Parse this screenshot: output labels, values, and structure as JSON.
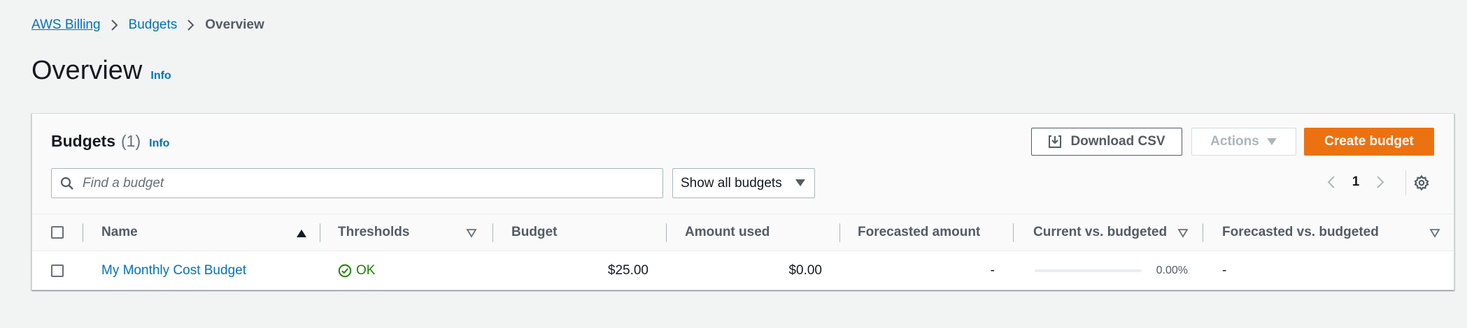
{
  "breadcrumb": {
    "items": [
      "AWS Billing",
      "Budgets"
    ],
    "current": "Overview"
  },
  "page": {
    "title": "Overview",
    "info": "Info"
  },
  "panel": {
    "title": "Budgets",
    "count": "(1)",
    "info": "Info",
    "download_label": "Download CSV",
    "actions_label": "Actions",
    "create_label": "Create budget",
    "search_placeholder": "Find a budget",
    "filter_value": "Show all budgets",
    "page_number": "1"
  },
  "table": {
    "columns": [
      "Name",
      "Thresholds",
      "Budget",
      "Amount used",
      "Forecasted amount",
      "Current vs. budgeted",
      "Forecasted vs. budgeted"
    ],
    "rows": [
      {
        "name": "My Monthly Cost Budget",
        "thresholds": "OK",
        "budget": "$25.00",
        "amount_used": "$0.00",
        "forecasted_amount": "-",
        "current_vs_budgeted": "0.00%",
        "current_vs_budgeted_fraction": 0,
        "forecasted_vs_budgeted": "-"
      }
    ]
  },
  "colors": {
    "link": "#0073bb",
    "primary_button": "#ec7211",
    "status_ok": "#1d8102"
  },
  "icons": [
    "chevron-right-icon",
    "download-icon",
    "caret-down-icon",
    "search-icon",
    "chevron-left-icon",
    "settings-icon",
    "sort-ascending-icon",
    "sort-icon",
    "status-ok-icon"
  ]
}
